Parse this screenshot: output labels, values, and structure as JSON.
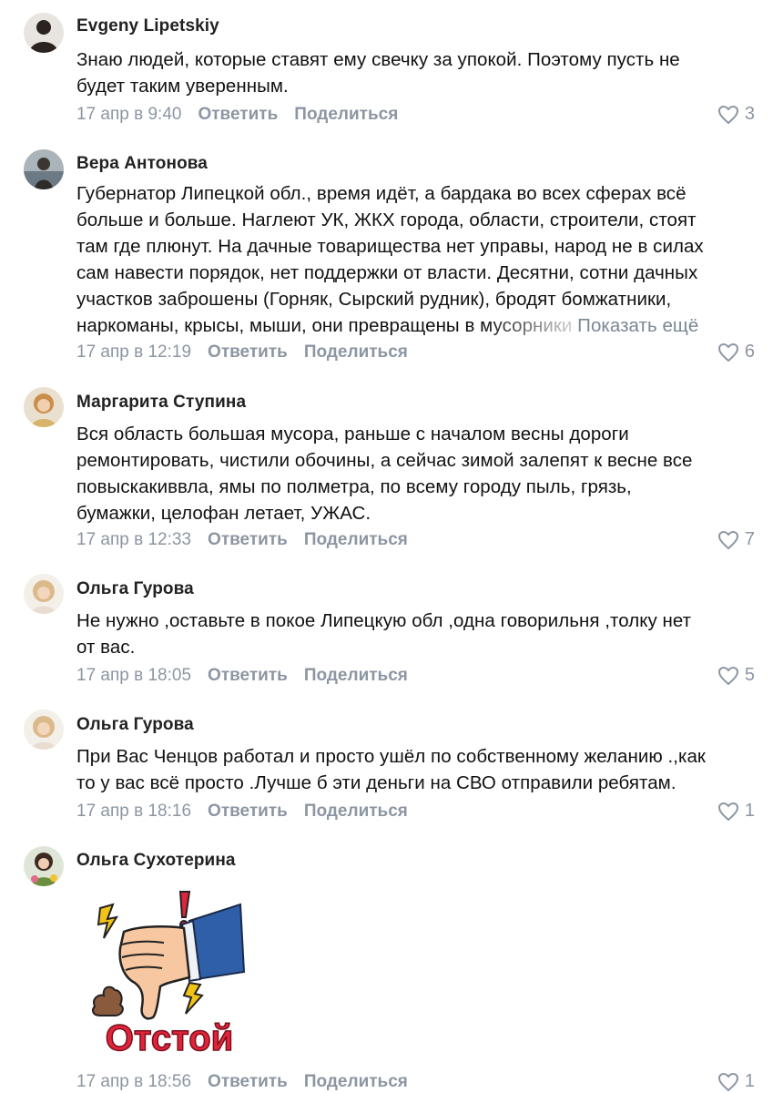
{
  "comments": [
    {
      "author": "Evgeny Lipetskiy",
      "lines": [
        "Знаю людей, которые ставят ему свечку за упокой. Поэтому пусть не",
        "будет таким уверенным."
      ],
      "date": "17 апр в 9:40",
      "reply": "Ответить",
      "share": "Поделиться",
      "likes": "3"
    },
    {
      "author": "Вера Антонова",
      "lines": [
        "Губернатор Липецкой обл., время идёт, а бардака во всех сферах всё",
        "больше и больше. Наглеют УК, ЖКХ города, области, строители, стоят",
        "там где плюнут. На дачные товарищества нет управы, народ не в силах",
        "сам навести порядок, нет поддержки от власти. Десятни, сотни дачных",
        "участков заброшены (Горняк, Сырский рудник), бродят бомжатники,",
        "наркоманы, крысы, мыши, они превращены в мусорники"
      ],
      "show_more": "Показать ещё",
      "date": "17 апр в 12:19",
      "reply": "Ответить",
      "share": "Поделиться",
      "likes": "6"
    },
    {
      "author": "Маргарита Ступина",
      "lines": [
        "Вся область большая мусора, раньше с началом весны дороги",
        "ремонтировать, чистили обочины, а сейчас зимой залепят к весне все",
        "повыскакиввла, ямы по полметра, по всему городу пыль, грязь,",
        "бумажки, целофан летает, УЖАС."
      ],
      "date": "17 апр в 12:33",
      "reply": "Ответить",
      "share": "Поделиться",
      "likes": "7"
    },
    {
      "author": "Ольга Гурова",
      "lines": [
        "Не нужно ,оставьте в покое Липецкую обл ,одна говорильня ,толку нет",
        "от вас."
      ],
      "date": "17 апр в 18:05",
      "reply": "Ответить",
      "share": "Поделиться",
      "likes": "5"
    },
    {
      "author": "Ольга Гурова",
      "lines": [
        "При Вас Ченцов работал и просто ушёл по собственному желанию .,как",
        "то у вас всё просто .Лучше б эти деньги на СВО отправили ребятам."
      ],
      "date": "17 апр в 18:16",
      "reply": "Ответить",
      "share": "Поделиться",
      "likes": "1"
    },
    {
      "author": "Ольга Сухотерина",
      "sticker_text": "Отстой",
      "date": "17 апр в 18:56",
      "reply": "Ответить",
      "share": "Поделиться",
      "likes": "1"
    }
  ],
  "colors": {
    "meta": "#8c96a2",
    "text": "#111111",
    "sticker_red": "#e0243a",
    "sticker_sleeve": "#2f5fa8"
  }
}
